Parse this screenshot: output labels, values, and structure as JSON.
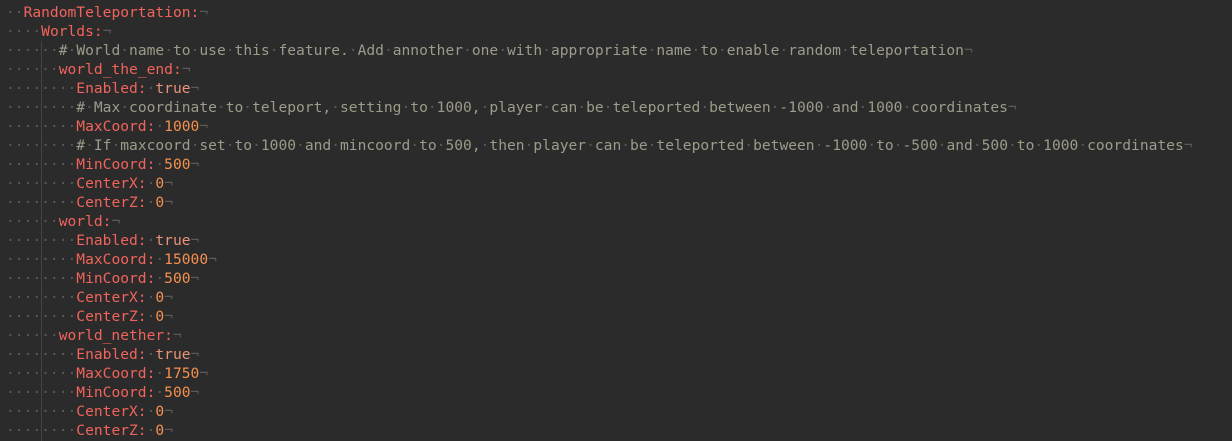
{
  "editor": {
    "lines": [
      {
        "indent": 2,
        "key": "RandomTeleportation",
        "value": ""
      },
      {
        "indent": 4,
        "key": "Worlds",
        "value": ""
      },
      {
        "indent": 6,
        "comment": "# World name to use this feature. Add annother one with appropriate name to enable random teleportation"
      },
      {
        "indent": 6,
        "key": "world_the_end",
        "value": ""
      },
      {
        "indent": 8,
        "key": "Enabled",
        "value": "true",
        "type": "bool"
      },
      {
        "indent": 8,
        "comment": "# Max coordinate to teleport, setting to 1000, player can be teleported between -1000 and 1000 coordinates"
      },
      {
        "indent": 8,
        "key": "MaxCoord",
        "value": "1000",
        "type": "num"
      },
      {
        "indent": 8,
        "comment": "# If maxcoord set to 1000 and mincoord to 500, then player can be teleported between -1000 to -500 and 500 to 1000 coordinates"
      },
      {
        "indent": 8,
        "key": "MinCoord",
        "value": "500",
        "type": "num"
      },
      {
        "indent": 8,
        "key": "CenterX",
        "value": "0",
        "type": "num"
      },
      {
        "indent": 8,
        "key": "CenterZ",
        "value": "0",
        "type": "num"
      },
      {
        "indent": 6,
        "key": "world",
        "value": ""
      },
      {
        "indent": 8,
        "key": "Enabled",
        "value": "true",
        "type": "bool"
      },
      {
        "indent": 8,
        "key": "MaxCoord",
        "value": "15000",
        "type": "num"
      },
      {
        "indent": 8,
        "key": "MinCoord",
        "value": "500",
        "type": "num"
      },
      {
        "indent": 8,
        "key": "CenterX",
        "value": "0",
        "type": "num"
      },
      {
        "indent": 8,
        "key": "CenterZ",
        "value": "0",
        "type": "num"
      },
      {
        "indent": 6,
        "key": "world_nether",
        "value": ""
      },
      {
        "indent": 8,
        "key": "Enabled",
        "value": "true",
        "type": "bool"
      },
      {
        "indent": 8,
        "key": "MaxCoord",
        "value": "1750",
        "type": "num"
      },
      {
        "indent": 8,
        "key": "MinCoord",
        "value": "500",
        "type": "num"
      },
      {
        "indent": 8,
        "key": "CenterX",
        "value": "0",
        "type": "num"
      },
      {
        "indent": 8,
        "key": "CenterZ",
        "value": "0",
        "type": "num"
      }
    ]
  },
  "colors": {
    "background": "#2b2b2b",
    "key": "#f0645c",
    "number": "#f5914f",
    "boolean": "#e8937a",
    "comment": "#9d9b8a",
    "whitespace": "#5a5a5a"
  }
}
